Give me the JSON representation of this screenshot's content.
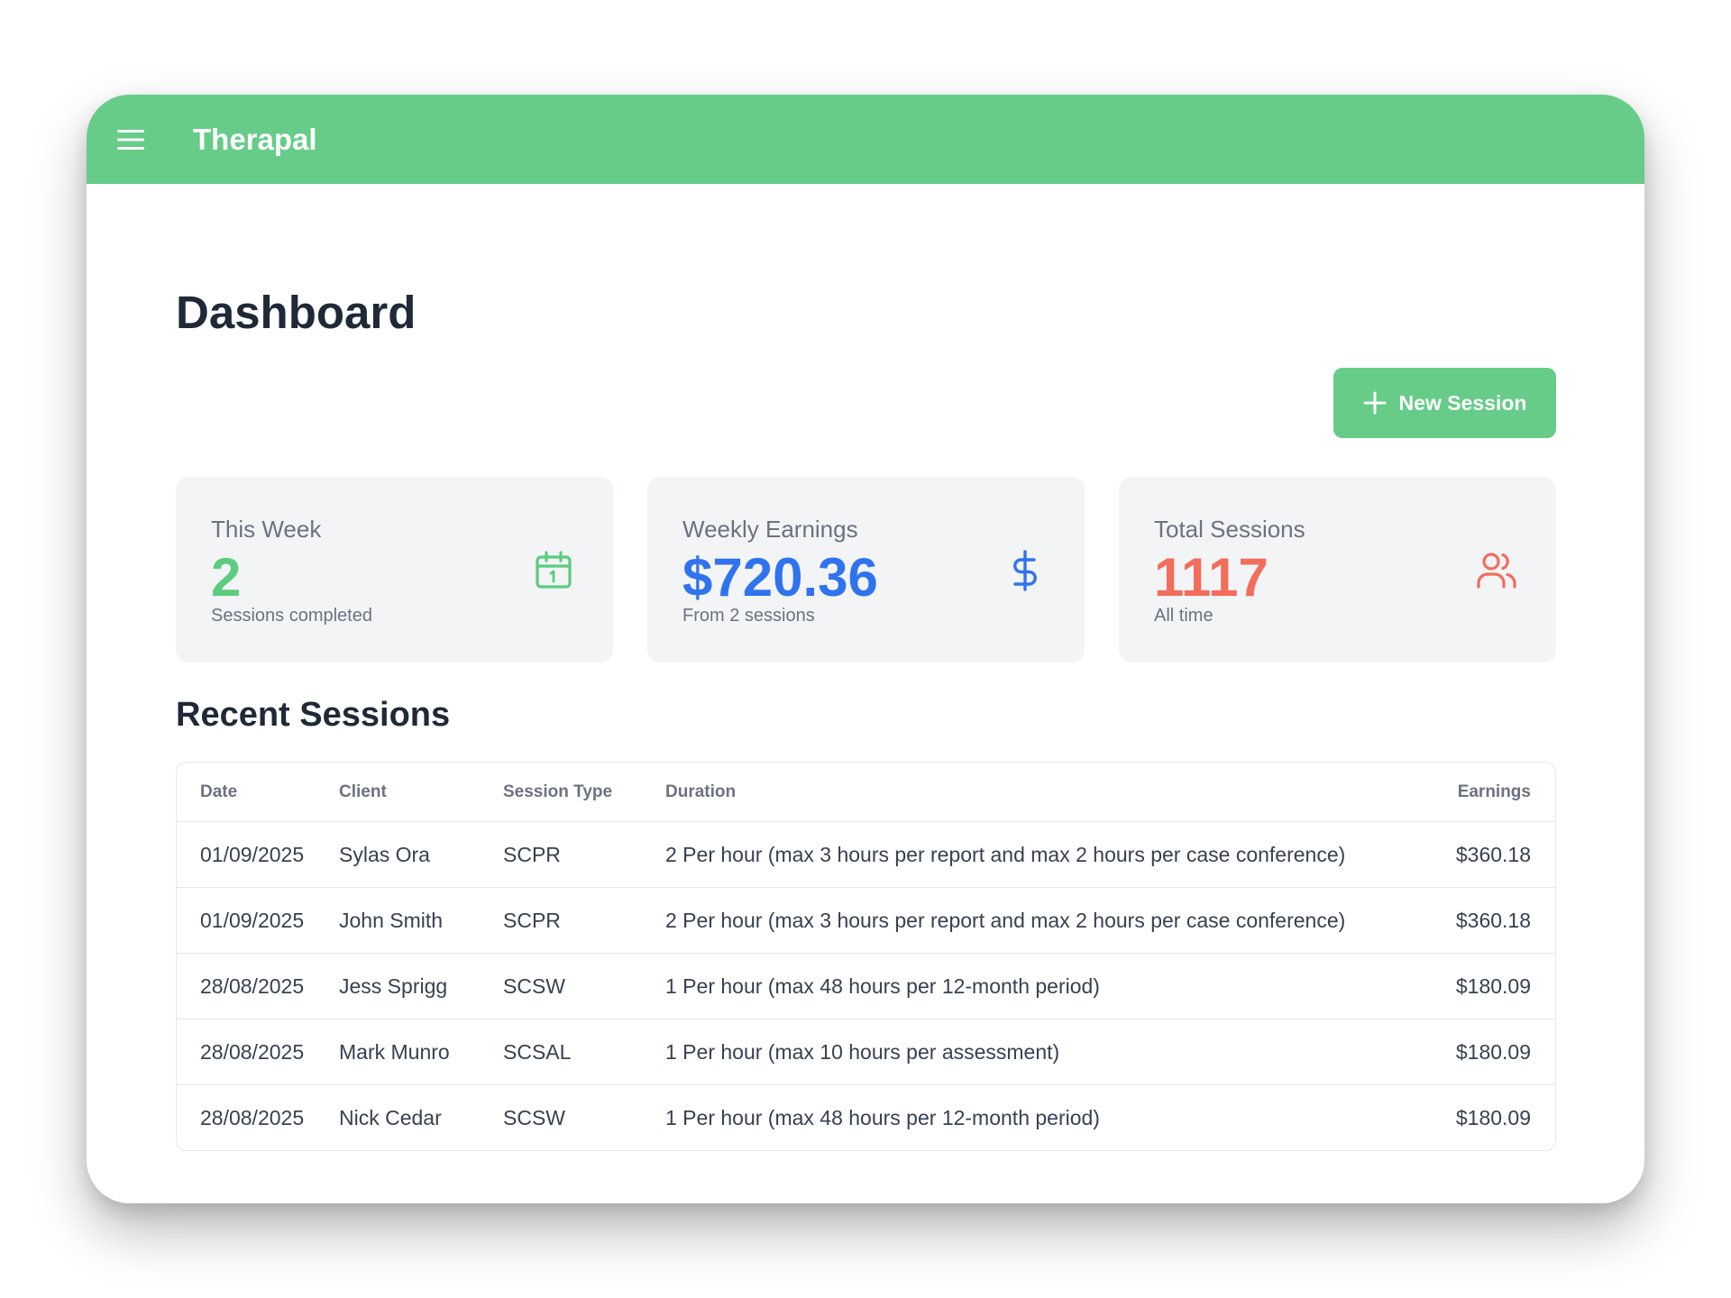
{
  "app": {
    "title": "Therapal",
    "brand_color": "#66cc88"
  },
  "page": {
    "title": "Dashboard",
    "new_session_label": "New Session"
  },
  "stats": [
    {
      "label": "This Week",
      "value": "2",
      "sub": "Sessions completed",
      "icon": "calendar-icon",
      "color": "#5ccc7f"
    },
    {
      "label": "Weekly Earnings",
      "value": "$720.36",
      "sub": "From 2 sessions",
      "icon": "dollar-icon",
      "color": "#2f73ee"
    },
    {
      "label": "Total Sessions",
      "value": "1117",
      "sub": "All time",
      "icon": "users-icon",
      "color": "#f26d5b"
    }
  ],
  "recent": {
    "title": "Recent Sessions",
    "columns": [
      "Date",
      "Client",
      "Session Type",
      "Duration",
      "Earnings"
    ],
    "rows": [
      {
        "date": "01/09/2025",
        "client": "Sylas Ora",
        "type": "SCPR",
        "duration": "2 Per hour (max 3 hours per report and max 2 hours per case conference)",
        "earnings": "$360.18"
      },
      {
        "date": "01/09/2025",
        "client": "John Smith",
        "type": "SCPR",
        "duration": "2 Per hour (max 3 hours per report and max 2 hours per case conference)",
        "earnings": "$360.18"
      },
      {
        "date": "28/08/2025",
        "client": "Jess Sprigg",
        "type": "SCSW",
        "duration": "1 Per hour (max 48 hours per 12-month period)",
        "earnings": "$180.09"
      },
      {
        "date": "28/08/2025",
        "client": "Mark Munro",
        "type": "SCSAL",
        "duration": "1 Per hour (max 10 hours per assessment)",
        "earnings": "$180.09"
      },
      {
        "date": "28/08/2025",
        "client": "Nick Cedar",
        "type": "SCSW",
        "duration": "1 Per hour (max 48 hours per 12-month period)",
        "earnings": "$180.09"
      }
    ]
  }
}
